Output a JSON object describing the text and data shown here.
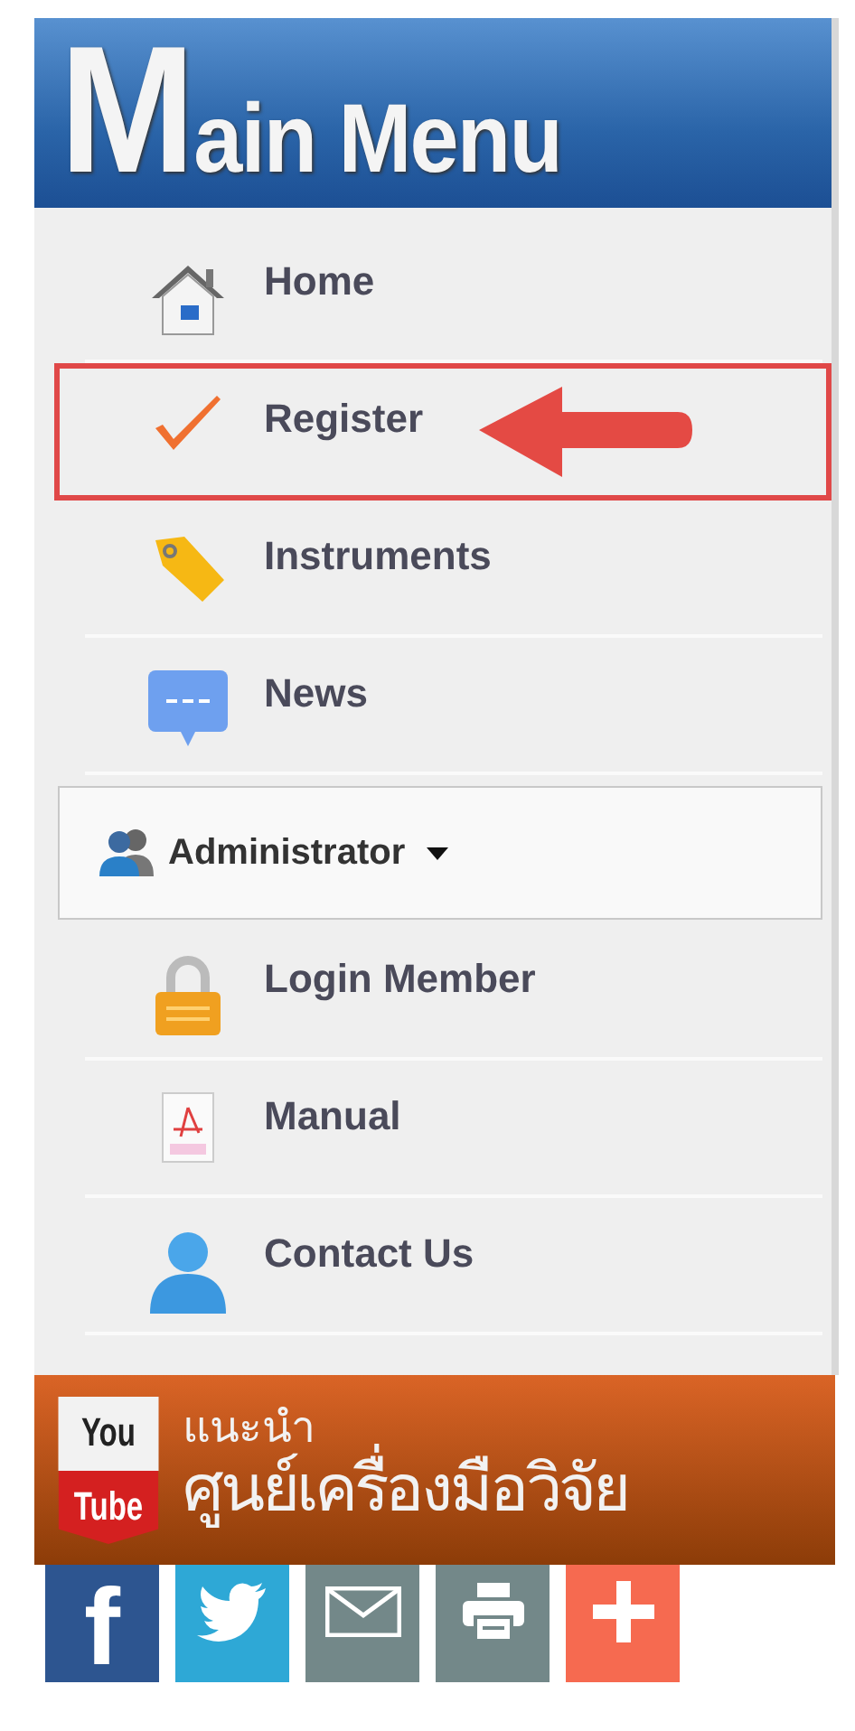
{
  "header": {
    "title": "Main Menu"
  },
  "menu": [
    {
      "kind": "link",
      "label": "Home",
      "highlighted": false
    },
    {
      "kind": "link",
      "label": "Register",
      "highlighted": true
    },
    {
      "kind": "link",
      "label": "Instruments",
      "highlighted": false
    },
    {
      "kind": "link",
      "label": "News",
      "highlighted": false
    },
    {
      "kind": "dropdown",
      "label": "Administrator"
    },
    {
      "kind": "link",
      "label": "Login Member",
      "highlighted": false
    },
    {
      "kind": "link",
      "label": "Manual",
      "highlighted": false
    },
    {
      "kind": "link",
      "label": "Contact Us",
      "highlighted": false
    }
  ],
  "banner": {
    "logo_top": "You",
    "logo_bottom": "Tube",
    "subtitle": "แนะนำ",
    "title": "ศูนย์เครื่องมือวิจัย"
  },
  "share": [
    {
      "kind": "facebook",
      "glyph": "f"
    },
    {
      "kind": "twitter"
    },
    {
      "kind": "email"
    },
    {
      "kind": "print"
    },
    {
      "kind": "more"
    }
  ]
}
